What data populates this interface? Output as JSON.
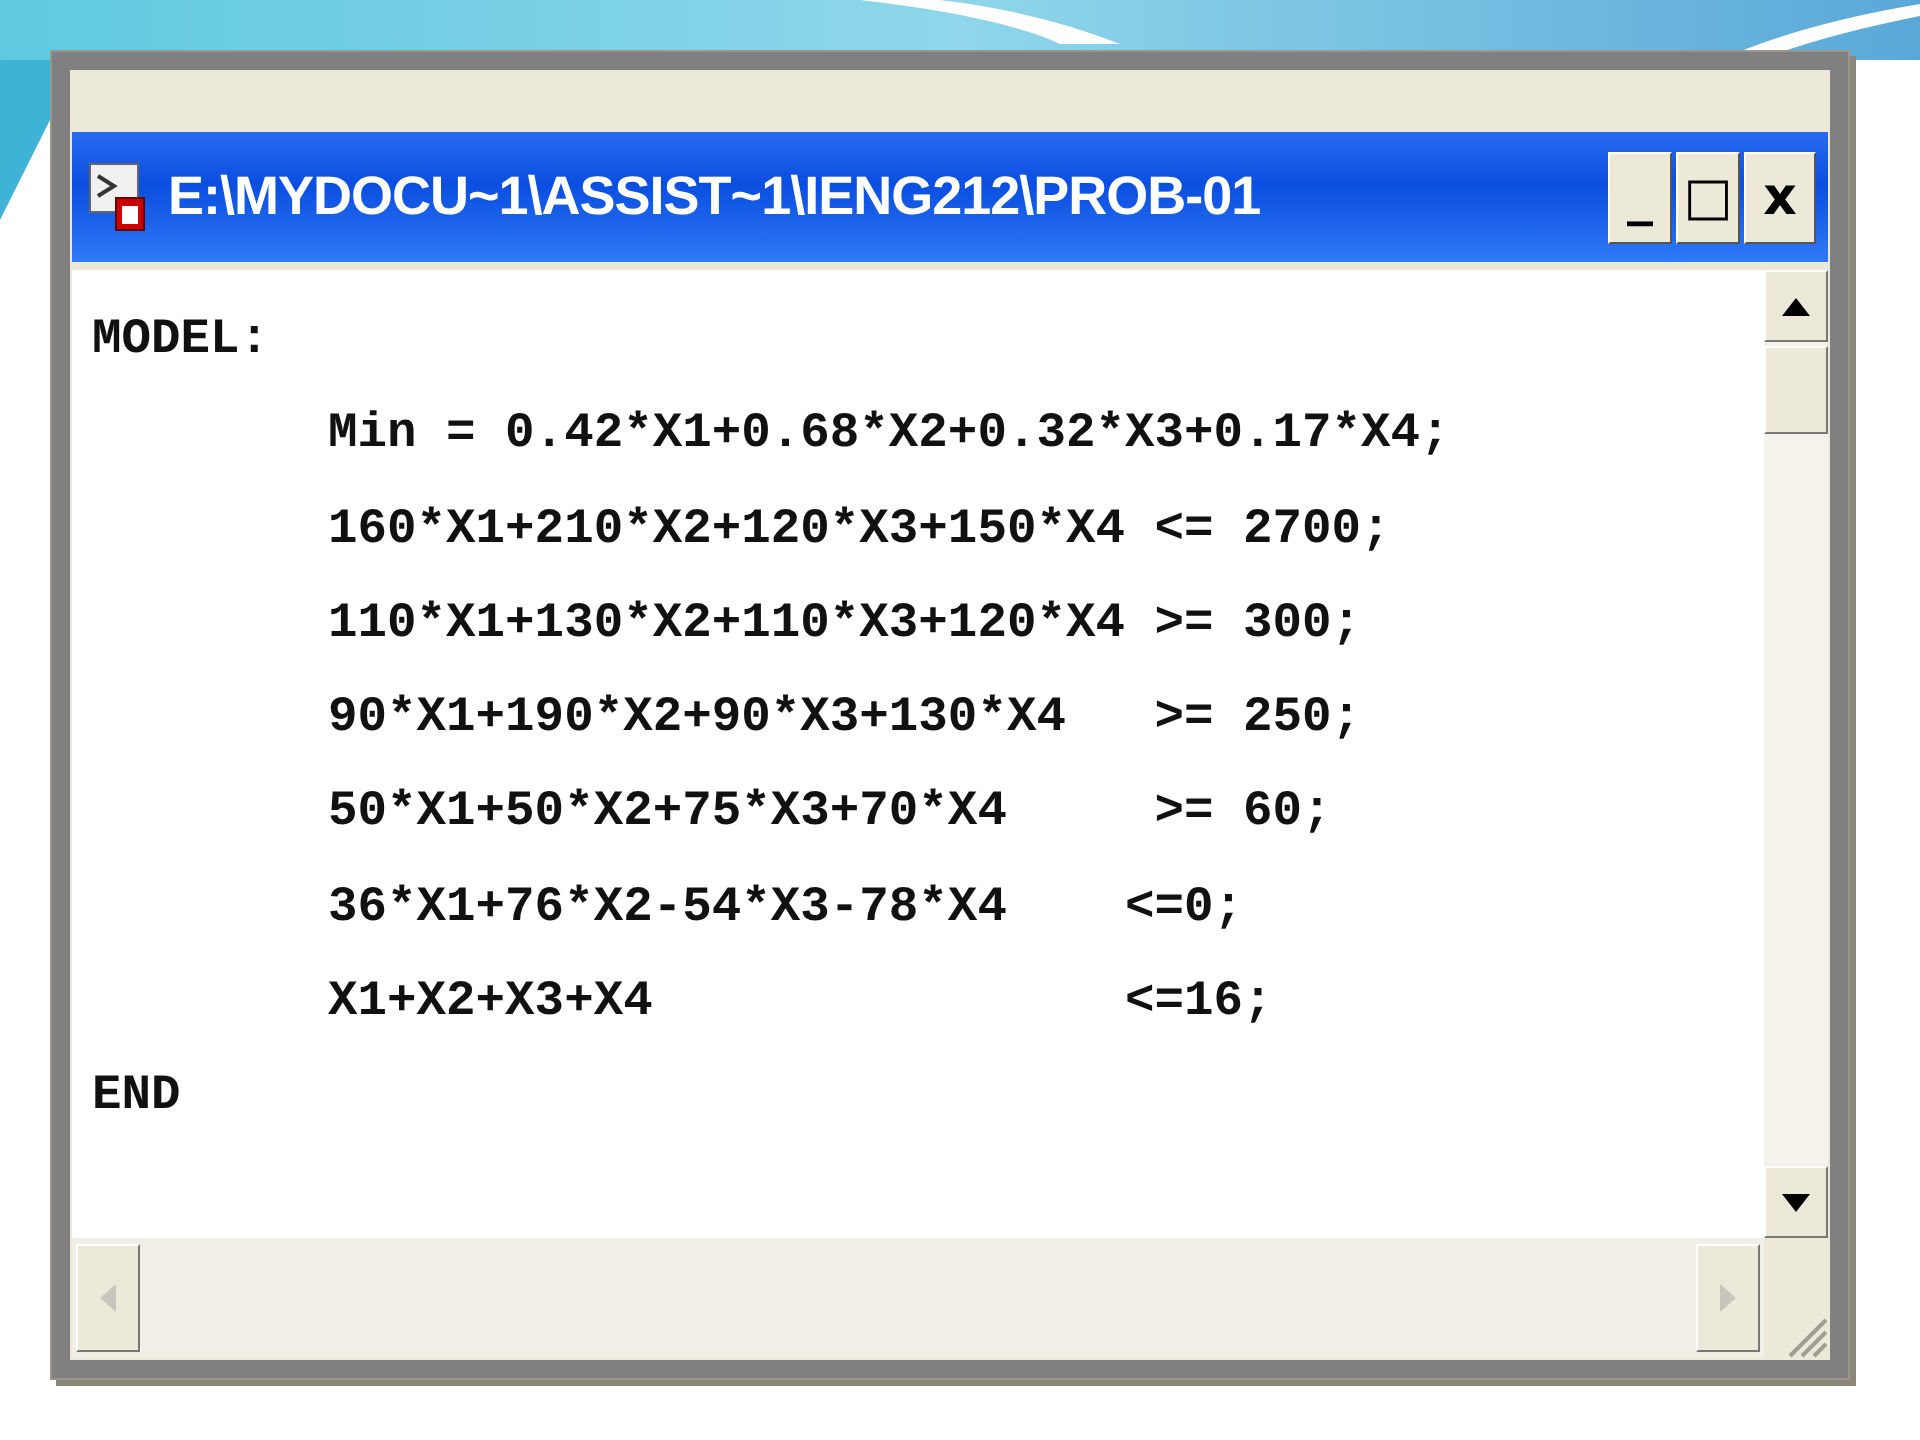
{
  "window": {
    "title": "E:\\MYDOCU~1\\ASSIST~1\\IENG212\\PROB-01",
    "buttons": [
      {
        "kind": "minimize",
        "label": "_"
      },
      {
        "kind": "maximize",
        "label": "□"
      },
      {
        "kind": "close",
        "label": "x"
      }
    ]
  },
  "editor": {
    "lines": [
      {
        "text": "MODEL:",
        "children": [
          {
            "text": "Min = 0.42*X1+0.68*X2+0.32*X3+0.17*X4;"
          },
          {
            "text": "160*X1+210*X2+120*X3+150*X4 <= 2700;"
          },
          {
            "text": "110*X1+130*X2+110*X3+120*X4 >= 300;"
          },
          {
            "text": "90*X1+190*X2+90*X3+130*X4   >= 250;"
          },
          {
            "text": "50*X1+50*X2+75*X3+70*X4     >= 60;"
          },
          {
            "text": "36*X1+76*X2-54*X3-78*X4    <=0;"
          },
          {
            "text": "X1+X2+X3+X4                <=16;"
          }
        ]
      },
      {
        "text": "END"
      }
    ]
  }
}
